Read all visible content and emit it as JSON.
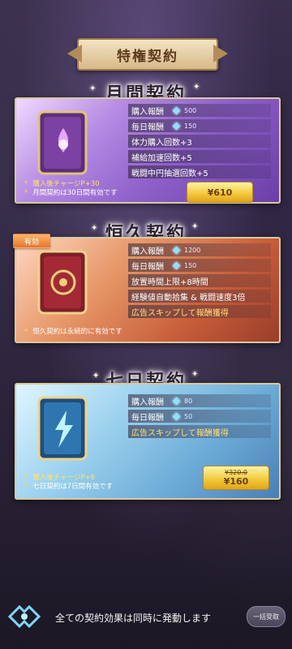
{
  "header": {
    "title": "特権契約"
  },
  "monthly": {
    "title": "月間契約",
    "rows": [
      {
        "label": "購入報酬",
        "value": "500",
        "gem": true
      },
      {
        "label": "毎日報酬",
        "value": "150",
        "gem": true
      },
      {
        "label": "体力購入回数+3"
      },
      {
        "label": "補給加速回数+5"
      },
      {
        "label": "戦闘中円抽選回数+5"
      }
    ],
    "note1": "購入後チャージP+30",
    "note2": "月間契約は30日間有効です",
    "price": "¥610"
  },
  "permanent": {
    "badge": "有効",
    "title": "恒久契約",
    "rows": [
      {
        "label": "購入報酬",
        "value": "1200",
        "gem": true
      },
      {
        "label": "毎日報酬",
        "value": "150",
        "gem": true
      },
      {
        "label": "放置時間上限+8時間"
      },
      {
        "label": "経験値自動拾集 & 戦闘速度3倍"
      },
      {
        "label": "広告スキップして報酬獲得",
        "highlight": true
      }
    ],
    "note": "恒久契約は永続的に有効です"
  },
  "weekly": {
    "title": "七日契約",
    "rows": [
      {
        "label": "購入報酬",
        "value": "80",
        "gem": true
      },
      {
        "label": "毎日報酬",
        "value": "50",
        "gem": true
      },
      {
        "label": "広告スキップして報酬獲得",
        "highlight": true
      }
    ],
    "note1": "購入後チャージP+6",
    "note2": "七日契約は7日間有効です",
    "old_price": "¥320.0",
    "price": "¥160"
  },
  "footer": {
    "message": "全ての契約効果は同時に発動します",
    "button": "一括受取"
  }
}
